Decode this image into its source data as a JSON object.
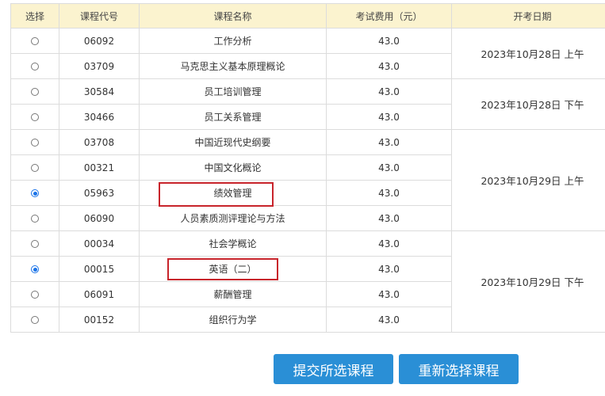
{
  "table": {
    "headers": {
      "select": "选择",
      "code": "课程代号",
      "name": "课程名称",
      "fee": "考试费用（元）",
      "date": "开考日期"
    },
    "rows": [
      {
        "code": "06092",
        "name": "工作分析",
        "fee": "43.0",
        "selected": false
      },
      {
        "code": "03709",
        "name": "马克思主义基本原理概论",
        "fee": "43.0",
        "selected": false
      },
      {
        "code": "30584",
        "name": "员工培训管理",
        "fee": "43.0",
        "selected": false
      },
      {
        "code": "30466",
        "name": "员工关系管理",
        "fee": "43.0",
        "selected": false
      },
      {
        "code": "03708",
        "name": "中国近现代史纲要",
        "fee": "43.0",
        "selected": false
      },
      {
        "code": "00321",
        "name": "中国文化概论",
        "fee": "43.0",
        "selected": false
      },
      {
        "code": "05963",
        "name": "绩效管理",
        "fee": "43.0",
        "selected": true
      },
      {
        "code": "06090",
        "name": "人员素质测评理论与方法",
        "fee": "43.0",
        "selected": false
      },
      {
        "code": "00034",
        "name": "社会学概论",
        "fee": "43.0",
        "selected": false
      },
      {
        "code": "00015",
        "name": "英语（二）",
        "fee": "43.0",
        "selected": true
      },
      {
        "code": "06091",
        "name": "薪酬管理",
        "fee": "43.0",
        "selected": false
      },
      {
        "code": "00152",
        "name": "组织行为学",
        "fee": "43.0",
        "selected": false
      }
    ],
    "date_groups": [
      {
        "label": "2023年10月28日 上午",
        "rowspan": 2
      },
      {
        "label": "2023年10月28日 下午",
        "rowspan": 2
      },
      {
        "label": "2023年10月29日 上午",
        "rowspan": 4
      },
      {
        "label": "2023年10月29日 下午",
        "rowspan": 4
      }
    ]
  },
  "actions": {
    "submit_label": "提交所选课程",
    "reset_label": "重新选择课程"
  },
  "colors": {
    "header_bg": "#fbf3cf",
    "button_bg": "#2a8fd6",
    "highlight_border": "#c8242b",
    "radio_checked": "#1a73e8"
  }
}
